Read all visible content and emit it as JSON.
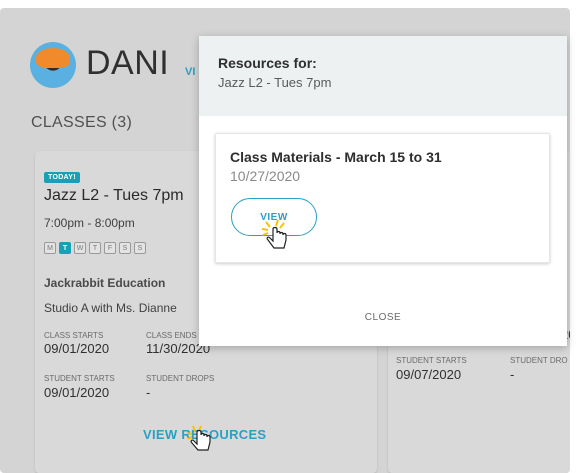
{
  "student": {
    "name": "DANI",
    "link_text": "VI"
  },
  "classes_heading": "CLASSES (3)",
  "class_card": {
    "badge": "TODAY!",
    "title": "Jazz L2 - Tues 7pm",
    "time": "7:00pm - 8:00pm",
    "days": [
      {
        "label": "M",
        "active": false
      },
      {
        "label": "T",
        "active": true
      },
      {
        "label": "W",
        "active": false
      },
      {
        "label": "T",
        "active": false
      },
      {
        "label": "F",
        "active": false
      },
      {
        "label": "S",
        "active": false
      },
      {
        "label": "S",
        "active": false
      }
    ],
    "org": "Jackrabbit Education",
    "location": "Studio A with Ms. Dianne",
    "class_starts_label": "CLASS STARTS",
    "class_starts_value": "09/01/2020",
    "class_ends_label": "CLASS ENDS",
    "class_ends_value": "11/30/2020",
    "student_starts_label": "STUDENT STARTS",
    "student_starts_value": "09/01/2020",
    "student_drops_label": "STUDENT DROPS",
    "student_drops_value": "-",
    "view_resources": "VIEW RESOURCES"
  },
  "class_card_right": {
    "date_partial": "20",
    "student_starts_label": "STUDENT STARTS",
    "student_starts_value": "09/07/2020",
    "student_drops_label": "STUDENT DRO",
    "student_drops_value": "-"
  },
  "modal": {
    "title": "Resources for:",
    "subtitle": "Jazz L2 - Tues 7pm",
    "resource": {
      "title": "Class Materials - March 15 to 31",
      "date": "10/27/2020",
      "view_label": "VIEW"
    },
    "close_label": "CLOSE"
  },
  "colors": {
    "accent": "#2aa0c5",
    "badge": "#1a9fb7",
    "overlay": "#d4d4d4"
  },
  "icons": [
    "avatar-photo",
    "hand-pointer-cursor-icon"
  ]
}
